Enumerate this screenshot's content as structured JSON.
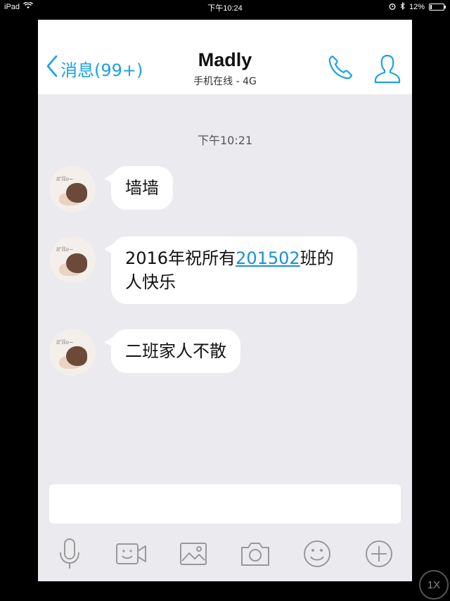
{
  "statusbar": {
    "device": "iPad",
    "time": "下午10:24",
    "battery": "12%",
    "battery_level": 0.12,
    "icons": [
      "wifi-icon",
      "alarm-icon",
      "bluetooth-icon",
      "battery-icon"
    ]
  },
  "header": {
    "back_label": "消息(99+)",
    "title": "Madly",
    "subtitle": "手机在线 - 4G",
    "accent_color": "#1aa1e6"
  },
  "chat": {
    "timestamp": "下午10:21",
    "messages": [
      {
        "text": "墙墙"
      },
      {
        "text_before": "2016年祝所有",
        "link": "201502",
        "text_after": "班的",
        "text_line2": "人快乐"
      },
      {
        "text": "二班家人不散"
      }
    ]
  },
  "toolbar": {
    "items": [
      "microphone-icon",
      "video-icon",
      "image-icon",
      "camera-icon",
      "emoji-icon",
      "plus-icon"
    ]
  },
  "zoom_label": "1X"
}
